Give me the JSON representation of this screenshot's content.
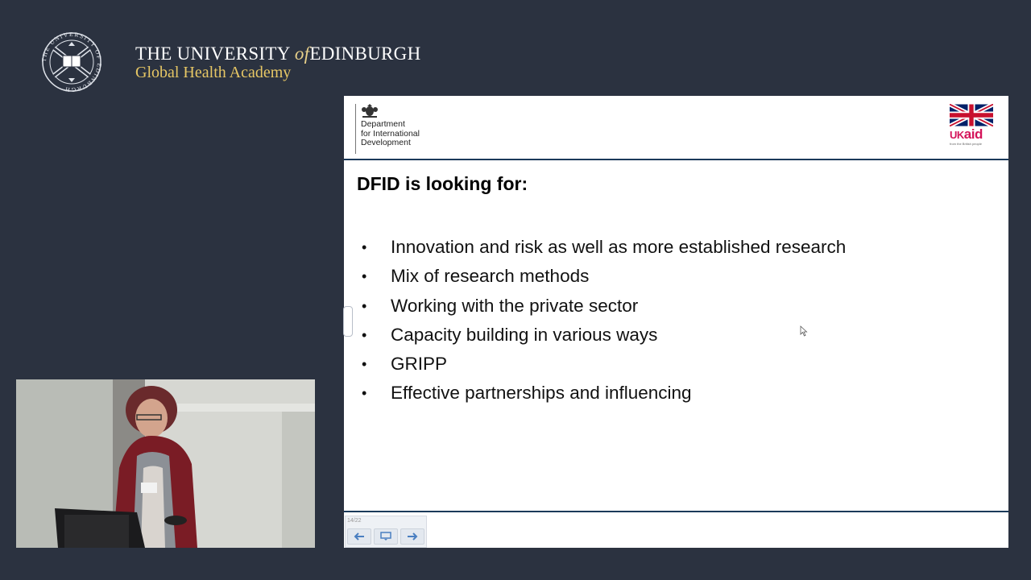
{
  "university": {
    "name_before": "THE UNIVERSITY",
    "name_of": "of",
    "name_after": "EDINBURGH",
    "subtitle": "Global Health Academy",
    "crest_text": "THE UNIVERSITY OF EDINBURGH",
    "crest_icon": "university-crest-icon"
  },
  "slide": {
    "dfid_logo_lines": [
      "Department",
      "for International",
      "Development"
    ],
    "dfid_crest_icon": "royal-coat-of-arms-icon",
    "ukaid": {
      "flag_icon": "union-jack-icon",
      "uk": "UK",
      "aid": "aid",
      "tagline": "from the British people"
    },
    "title": "DFID is looking for:",
    "bullets": [
      "Innovation and risk as well as more established research",
      "Mix of research methods",
      "Working with the private sector",
      "Capacity building in various ways",
      "GRIPP",
      "Effective partnerships and influencing"
    ],
    "bullet_glyph": "•",
    "navigation": {
      "counter": "14/22",
      "prev_icon": "arrow-left-icon",
      "menu_icon": "slide-menu-icon",
      "next_icon": "arrow-right-icon"
    }
  },
  "colors": {
    "background": "#2b3240",
    "gold": "#e7c765",
    "rule": "#1b3a5a",
    "ukaid_pink": "#d4145a"
  },
  "video": {
    "content": "speaker-video-feed"
  }
}
